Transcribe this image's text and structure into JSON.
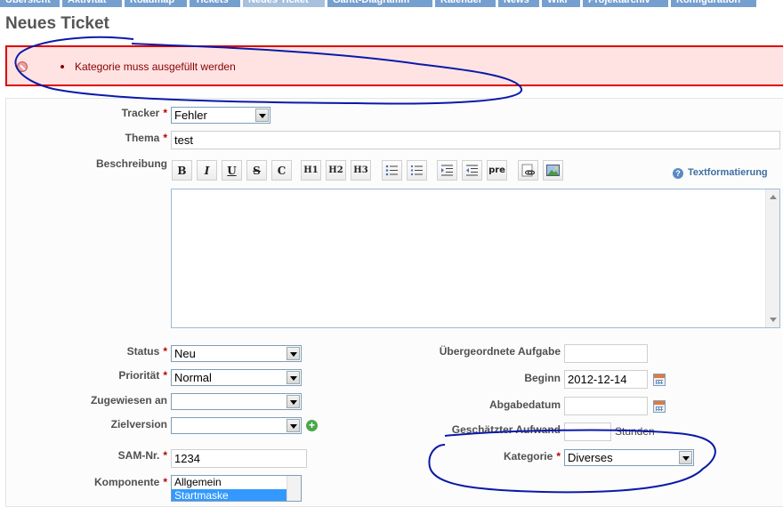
{
  "nav": {
    "tabs": [
      {
        "label": "Übersicht",
        "selected": false
      },
      {
        "label": "Aktivität",
        "selected": false
      },
      {
        "label": "Roadmap",
        "selected": false
      },
      {
        "label": "Tickets",
        "selected": false
      },
      {
        "label": "Neues Ticket",
        "selected": true
      },
      {
        "label": "Gantt-Diagramm",
        "selected": false
      },
      {
        "label": "Kalender",
        "selected": false
      },
      {
        "label": "News",
        "selected": false
      },
      {
        "label": "Wiki",
        "selected": false
      },
      {
        "label": "Projektarchiv",
        "selected": false
      },
      {
        "label": "Konfiguration",
        "selected": false
      }
    ]
  },
  "page": {
    "title": "Neues Ticket"
  },
  "errors": {
    "items": [
      "Kategorie muss ausgefüllt werden"
    ]
  },
  "form": {
    "required_marker": "*",
    "tracker": {
      "label": "Tracker",
      "value": "Fehler"
    },
    "subject": {
      "label": "Thema",
      "value": "test"
    },
    "description": {
      "label": "Beschreibung",
      "help_link": "Textformatierung",
      "toolbar": [
        "B",
        "I",
        "U",
        "S",
        "C",
        "H1",
        "H2",
        "H3",
        "ul",
        "ol",
        "indent",
        "outdent",
        "pre",
        "link",
        "image"
      ],
      "toolbar_glyphs": {
        "pre": "pre"
      }
    },
    "status": {
      "label": "Status",
      "value": "Neu"
    },
    "priority": {
      "label": "Priorität",
      "value": "Normal"
    },
    "assignee": {
      "label": "Zugewiesen an",
      "value": ""
    },
    "target_version": {
      "label": "Zielversion",
      "value": ""
    },
    "sam_nr": {
      "label": "SAM-Nr.",
      "value": "1234"
    },
    "component": {
      "label": "Komponente",
      "options": [
        "Allgemein",
        "Startmaske"
      ],
      "selected_index": 1
    },
    "parent_task": {
      "label": "Übergeordnete Aufgabe",
      "value": ""
    },
    "start_date": {
      "label": "Beginn",
      "value": "2012-12-14"
    },
    "due_date": {
      "label": "Abgabedatum",
      "value": ""
    },
    "estimated_time": {
      "label": "Geschätzter Aufwand",
      "value": "",
      "unit": "Stunden"
    },
    "category": {
      "label": "Kategorie",
      "value": "Diverses"
    }
  },
  "annotation": {
    "color": "#0a1aa8"
  }
}
